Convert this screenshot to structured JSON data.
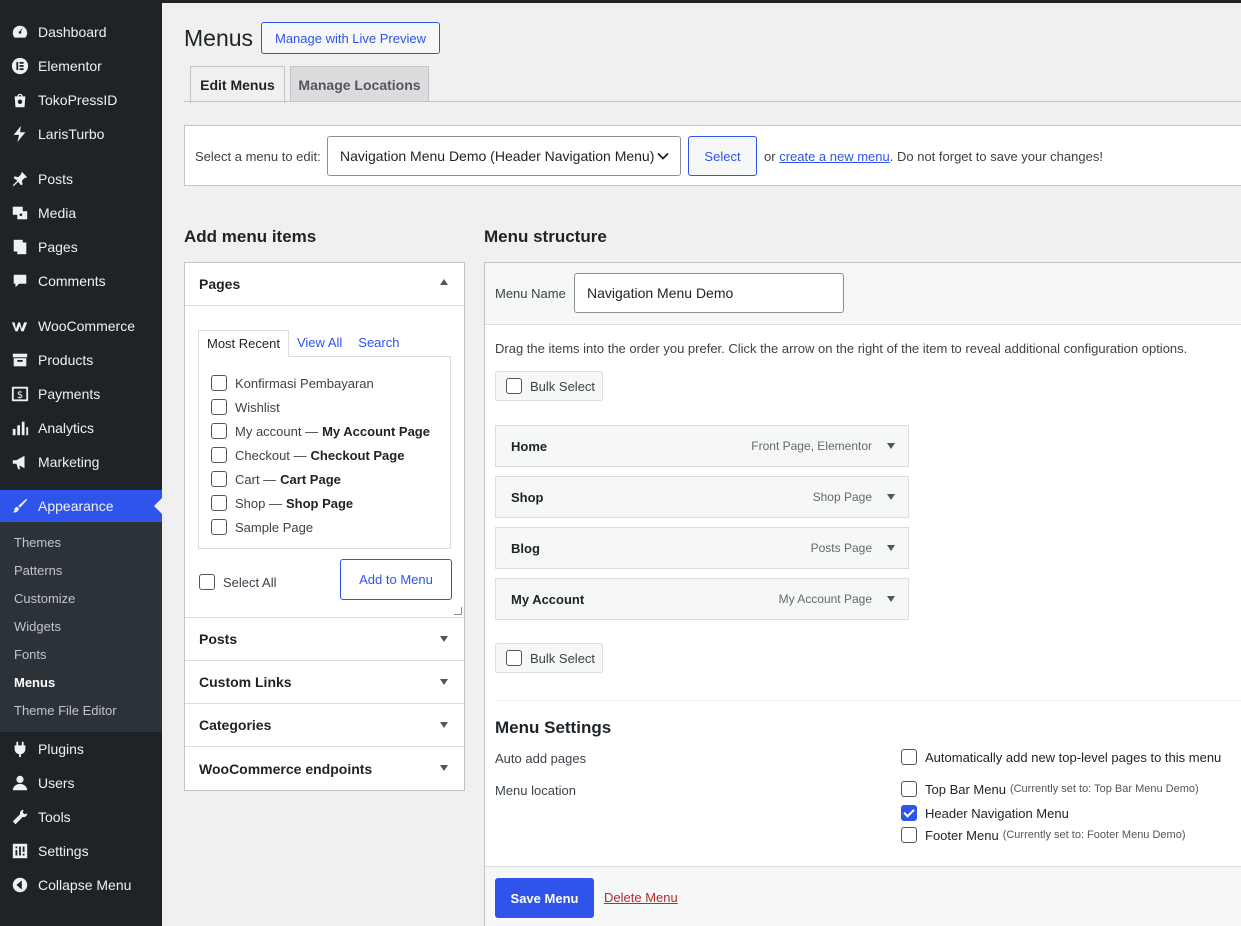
{
  "sidebar": {
    "items_top": [
      {
        "label": "Dashboard",
        "icon": "dashboard-icon"
      },
      {
        "label": "Elementor",
        "icon": "elementor-icon"
      },
      {
        "label": "TokoPressID",
        "icon": "tokopress-icon"
      },
      {
        "label": "LarisTurbo",
        "icon": "laristurbo-icon"
      }
    ],
    "items_content": [
      {
        "label": "Posts",
        "icon": "pin-icon"
      },
      {
        "label": "Media",
        "icon": "media-icon"
      },
      {
        "label": "Pages",
        "icon": "pages-icon"
      },
      {
        "label": "Comments",
        "icon": "comment-icon"
      }
    ],
    "items_shop": [
      {
        "label": "WooCommerce",
        "icon": "woo-icon"
      },
      {
        "label": "Products",
        "icon": "archive-icon"
      },
      {
        "label": "Payments",
        "icon": "dollar-icon"
      },
      {
        "label": "Analytics",
        "icon": "chart-icon"
      },
      {
        "label": "Marketing",
        "icon": "megaphone-icon"
      }
    ],
    "appearance": "Appearance",
    "submenu": [
      "Themes",
      "Patterns",
      "Customize",
      "Widgets",
      "Fonts",
      "Menus",
      "Theme File Editor"
    ],
    "items_bottom": [
      {
        "label": "Plugins",
        "icon": "plugin-icon"
      },
      {
        "label": "Users",
        "icon": "user-icon"
      },
      {
        "label": "Tools",
        "icon": "wrench-icon"
      },
      {
        "label": "Settings",
        "icon": "settings-icon"
      },
      {
        "label": "Collapse Menu",
        "icon": "collapse-icon"
      }
    ]
  },
  "header": {
    "title": "Menus",
    "live_preview": "Manage with Live Preview",
    "tab_edit": "Edit Menus",
    "tab_locations": "Manage Locations"
  },
  "select_bar": {
    "label": "Select a menu to edit:",
    "selected": "Navigation Menu Demo (Header Navigation Menu)",
    "button": "Select",
    "hint_prefix": "or",
    "hint_link": "create a new menu",
    "hint_suffix": ". Do not forget to save your changes!"
  },
  "add_items": {
    "title": "Add menu items",
    "pages_title": "Pages",
    "tabs": [
      "Most Recent",
      "View All",
      "Search"
    ],
    "pages": [
      {
        "name": "Konfirmasi Pembayaran",
        "tag": ""
      },
      {
        "name": "Wishlist",
        "tag": ""
      },
      {
        "name": "My account —",
        "tag": "My Account Page"
      },
      {
        "name": "Checkout —",
        "tag": "Checkout Page"
      },
      {
        "name": "Cart —",
        "tag": "Cart Page"
      },
      {
        "name": "Shop —",
        "tag": "Shop Page"
      },
      {
        "name": "Sample Page",
        "tag": ""
      }
    ],
    "select_all": "Select All",
    "add_button": "Add to Menu",
    "sections": [
      "Posts",
      "Custom Links",
      "Categories",
      "WooCommerce endpoints"
    ]
  },
  "structure": {
    "title": "Menu structure",
    "name_label": "Menu Name",
    "name_value": "Navigation Menu Demo",
    "drag_hint": "Drag the items into the order you prefer. Click the arrow on the right of the item to reveal additional configuration options.",
    "bulk_select": "Bulk Select",
    "items": [
      {
        "title": "Home",
        "type": "Front Page, Elementor"
      },
      {
        "title": "Shop",
        "type": "Shop Page"
      },
      {
        "title": "Blog",
        "type": "Posts Page"
      },
      {
        "title": "My Account",
        "type": "My Account Page"
      }
    ],
    "settings_title": "Menu Settings",
    "auto_add_label": "Auto add pages",
    "auto_add_option": "Automatically add new top-level pages to this menu",
    "location_label": "Menu location",
    "locations": [
      {
        "name": "Top Bar Menu",
        "note": "(Currently set to: Top Bar Menu Demo)",
        "checked": false
      },
      {
        "name": "Header Navigation Menu",
        "note": "",
        "checked": true
      },
      {
        "name": "Footer Menu",
        "note": "(Currently set to: Footer Menu Demo)",
        "checked": false
      }
    ],
    "save_button": "Save Menu",
    "delete_link": "Delete Menu"
  },
  "colors": {
    "sidebar_bg": "#1d2327",
    "accent": "#2f54eb",
    "delete": "#b32d2e"
  }
}
